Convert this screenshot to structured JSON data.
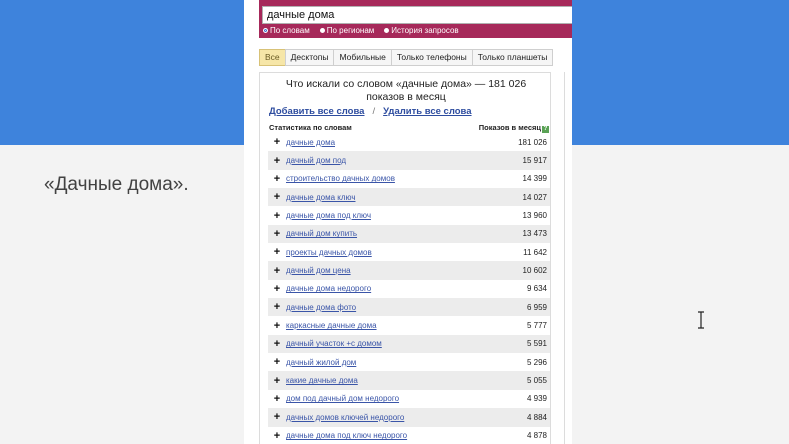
{
  "slide": {
    "caption": "«Дачные дома»."
  },
  "search": {
    "query": "дачные дома",
    "modes": [
      {
        "label": "По словам",
        "selected": true
      },
      {
        "label": "По регионам",
        "selected": false
      },
      {
        "label": "История запросов",
        "selected": false
      }
    ]
  },
  "tabs": [
    {
      "label": "Все",
      "active": true
    },
    {
      "label": "Десктопы",
      "active": false
    },
    {
      "label": "Мобильные",
      "active": false
    },
    {
      "label": "Только телефоны",
      "active": false
    },
    {
      "label": "Только планшеты",
      "active": false
    }
  ],
  "panel": {
    "heading_line1": "Что искали со словом «дачные дома» — 181 026",
    "heading_line2": "показов в месяц",
    "add_all": "Добавить все слова",
    "separator": "/",
    "remove_all": "Удалить все слова",
    "col_words": "Статистика по словам",
    "col_shows": "Показов в месяц",
    "help": "?"
  },
  "rows": [
    {
      "phrase": "дачные дома",
      "count": "181 026"
    },
    {
      "phrase": "дачный дом под",
      "count": "15 917"
    },
    {
      "phrase": "строительство дачных домов",
      "count": "14 399"
    },
    {
      "phrase": "дачные дома ключ",
      "count": "14 027"
    },
    {
      "phrase": "дачные дома под ключ",
      "count": "13 960"
    },
    {
      "phrase": "дачный дом купить",
      "count": "13 473"
    },
    {
      "phrase": "проекты дачных домов",
      "count": "11 642"
    },
    {
      "phrase": "дачный дом цена",
      "count": "10 602"
    },
    {
      "phrase": "дачные дома недорого",
      "count": "9 634"
    },
    {
      "phrase": "дачные дома фото",
      "count": "6 959"
    },
    {
      "phrase": "каркасные дачные дома",
      "count": "5 777"
    },
    {
      "phrase": "дачный участок +с домом",
      "count": "5 591"
    },
    {
      "phrase": "дачный жилой дом",
      "count": "5 296"
    },
    {
      "phrase": "какие дачные дома",
      "count": "5 055"
    },
    {
      "phrase": "дом под дачный дом недорого",
      "count": "4 939"
    },
    {
      "phrase": "дачных домов ключей недорого",
      "count": "4 884"
    },
    {
      "phrase": "дачные дома под ключ недорого",
      "count": "4 878"
    }
  ]
}
